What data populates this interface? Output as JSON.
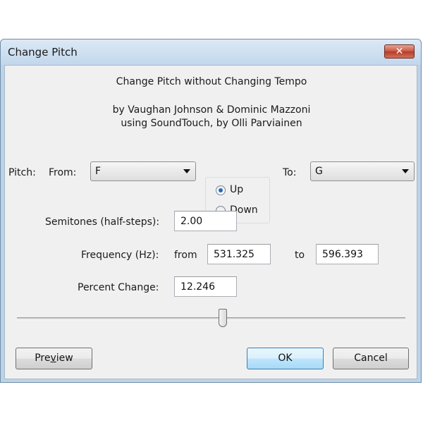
{
  "window": {
    "title": "Change Pitch",
    "close_glyph": "✕"
  },
  "header": {
    "line1": "Change Pitch without Changing Tempo",
    "line2": "by Vaughan Johnson & Dominic Mazzoni",
    "line3": "using SoundTouch, by Olli Parviainen"
  },
  "pitch": {
    "label": "Pitch:",
    "from_label": "From:",
    "from_value": "F",
    "direction": {
      "up_label": "Up",
      "down_label": "Down",
      "selected": "Up"
    },
    "to_label": "To:",
    "to_value": "G"
  },
  "semitones": {
    "label": "Semitones (half-steps):",
    "value": "2.00"
  },
  "frequency": {
    "label": "Frequency (Hz):",
    "from_label": "from",
    "from_value": "531.325",
    "to_label": "to",
    "to_value": "596.393"
  },
  "percent": {
    "label": "Percent Change:",
    "value": "12.246"
  },
  "slider": {
    "level": 0.53
  },
  "buttons": {
    "preview_pre": "Pre",
    "preview_ul": "v",
    "preview_post": "iew",
    "ok": "OK",
    "cancel": "Cancel"
  },
  "colors": {
    "titlebar": "#c2d7ec",
    "close_button": "#c8553f",
    "default_button_border": "#3c7fb1",
    "radio_dot": "#2a68b8"
  }
}
